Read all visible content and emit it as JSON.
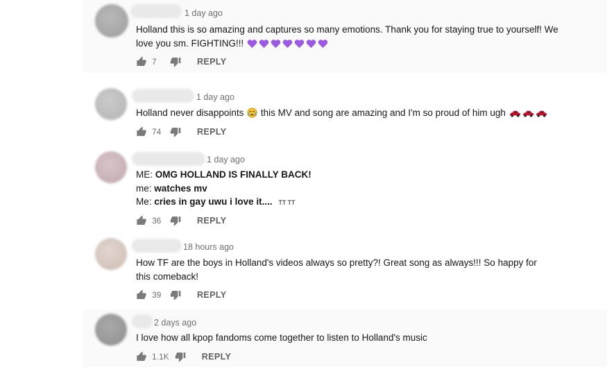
{
  "comments": [
    {
      "time": "1 day ago",
      "text": "Holland this is so amazing and captures so many emotions. Thank you for staying true to yourself! We love you sm. FIGHTING!!!",
      "emoji": "purple-heart-icon",
      "emoji_count": 7,
      "likes": "7",
      "reply_label": "REPLY"
    },
    {
      "time": "1 day ago",
      "text_before": "Holland never disappoints",
      "text_after": "this MV and song are amazing and I'm so proud of him ugh",
      "likes": "74",
      "reply_label": "REPLY"
    },
    {
      "time": "1 day ago",
      "lines": [
        {
          "speaker": "ME:",
          "content": "OMG HOLLAND IS FINALLY BACK!"
        },
        {
          "speaker": "me:",
          "content": "watches mv"
        },
        {
          "speaker": "Me:",
          "content": "cries in gay uwu i love it....",
          "suffix": "TT TT"
        }
      ],
      "likes": "36",
      "reply_label": "REPLY"
    },
    {
      "time": "18 hours ago",
      "text": "How TF are the boys in Holland's videos always so pretty?! Great song as always!!! So happy for this comeback!",
      "likes": "39",
      "reply_label": "REPLY"
    },
    {
      "time": "2 days ago",
      "text": "I love how all kpop fandoms come together to listen to Holland's music",
      "likes": "1.1K",
      "reply_label": "REPLY"
    }
  ],
  "colors": {
    "muted": "#6f6f6f",
    "purple_heart": "#9b59e4",
    "red_car": "#c8102e"
  }
}
